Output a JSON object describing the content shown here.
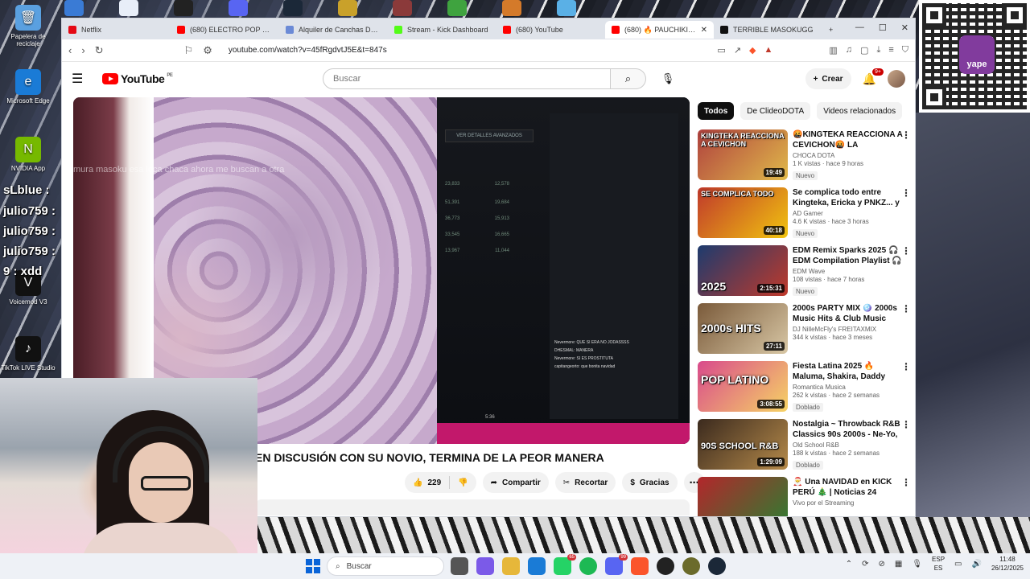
{
  "desktop": {
    "icons": [
      {
        "label": "Papelera de reciclaje",
        "color": "#5aa0e0",
        "glyph": "🗑"
      },
      {
        "label": "Microsoft Edge",
        "color": "#1a7bd6",
        "glyph": "e"
      },
      {
        "label": "NVIDIA App",
        "color": "#76b900",
        "glyph": "N"
      },
      {
        "label": "Voicemod V3",
        "color": "#111111",
        "glyph": "V"
      },
      {
        "label": "TikTok LIVE Studio",
        "color": "#111111",
        "glyph": "♪"
      }
    ],
    "overlay_names": [
      "sLblue :",
      "julio759 :",
      "julio759 :",
      "julio759 :",
      "9 : xdd"
    ]
  },
  "browser": {
    "tabs": [
      {
        "label": "Netflix",
        "favicon_color": "#e50914",
        "active": false
      },
      {
        "label": "(680) ELECTRO POP MIX 2025",
        "favicon_color": "#ff0000",
        "active": false
      },
      {
        "label": "Alquiler de Canchas Deporti",
        "favicon_color": "#6b8ad6",
        "active": false
      },
      {
        "label": "Stream - Kick Dashboard",
        "favicon_color": "#53fc18",
        "active": false
      },
      {
        "label": "(680) YouTube",
        "favicon_color": "#ff0000",
        "active": false
      },
      {
        "label": "(680) 🔥 PAUCHIKITA PI",
        "favicon_color": "#ff0000",
        "active": true
      },
      {
        "label": "TERRIBLE MASOKUGG",
        "favicon_color": "#111111",
        "active": false
      }
    ],
    "url": "youtube.com/watch?v=45fRgdvtJ5E&t=847s"
  },
  "youtube": {
    "logo_text": "YouTube",
    "region": "PE",
    "search_placeholder": "Buscar",
    "create_label": "Crear",
    "notif_count": "9+",
    "video": {
      "title": "EN DISCUSIÓN CON SU NOVIO, TERMINA DE LA PEOR MANERA",
      "overlay_caption": "mura masoku esa loca chaca ahora me buscan a otra",
      "stream_button": "VER DETALLES AVANZADOS",
      "stream_time": "5:36",
      "likes": "229",
      "share_label": "Compartir",
      "clip_label": "Recortar",
      "thanks_label": "Gracias"
    },
    "chips": [
      "Todos",
      "De ClideoDOTA",
      "Videos relacionados"
    ],
    "recommendations": [
      {
        "title": "🤬KINGTEKA REACCIONA A CEVICHON🤬 LA DECADENCI...",
        "channel": "CHOCA DOTA",
        "meta": "1 K vistas · hace 9 horas",
        "badge": "Nuevo",
        "duration": "19:49",
        "thumb_text": "KINGTEKA REACCIONA A CEVICHON",
        "thumb_color": "#b0413e"
      },
      {
        "title": "Se complica todo entre Kingteka, Ericka y PNKZ... y ...",
        "channel": "AD Gamer",
        "meta": "4.6 K vistas · hace 3 horas",
        "badge": "Nuevo",
        "duration": "40:18",
        "thumb_text": "SE COMPLICA TODO",
        "thumb_color": "#c0392b"
      },
      {
        "title": "EDM Remix Sparks 2025 🎧 EDM Compilation Playlist 🎧 ...",
        "channel": "EDM Wave",
        "meta": "108 vistas · hace 7 horas",
        "badge": "Nuevo",
        "duration": "2:15:31",
        "thumb_text": "2025",
        "thumb_color": "#1d3b6e"
      },
      {
        "title": "2000s PARTY MIX 🪩 2000s Music Hits & Club Music Mixe...",
        "channel": "DJ NilleMcFly's FREITAXMIX",
        "meta": "344 k vistas · hace 3 meses",
        "badge": "",
        "duration": "27:11",
        "thumb_text": "2000s HITS",
        "thumb_color": "#7a5a3a"
      },
      {
        "title": "Fiesta Latina 2025 🔥 Maluma, Shakira, Daddy Yankee, Wisin, ...",
        "channel": "Romantica Musica",
        "meta": "262 k vistas · hace 2 semanas",
        "badge": "Doblado",
        "duration": "3:08:55",
        "thumb_text": "POP LATINO",
        "thumb_color": "#d94a8c"
      },
      {
        "title": "Nostalgia ~ Throwback R&B Classics 90s 2000s - Ne-Yo, ...",
        "channel": "Old School R&B",
        "meta": "188 k vistas · hace 2 semanas",
        "badge": "Doblado",
        "duration": "1:29:09",
        "thumb_text": "90S SCHOOL R&B",
        "thumb_color": "#5a3d2b"
      },
      {
        "title": "🎅 Una NAVIDAD en KICK PERÚ 🎄 | Noticias 24 diciembre",
        "channel": "Vivo por el Streaming",
        "meta": "",
        "badge": "",
        "duration": "",
        "thumb_text": "",
        "thumb_color": "#b3262b"
      }
    ]
  },
  "qr": {
    "brand": "yape"
  },
  "taskbar": {
    "search_placeholder": "Buscar",
    "apps": [
      {
        "name": "file-explorer",
        "color": "#555",
        "badge": ""
      },
      {
        "name": "copilot",
        "color": "#7b5ae8",
        "badge": ""
      },
      {
        "name": "folder",
        "color": "#e6b73a",
        "badge": ""
      },
      {
        "name": "edge",
        "color": "#1a7bd6",
        "badge": ""
      },
      {
        "name": "whatsapp",
        "color": "#25d366",
        "badge": "65"
      },
      {
        "name": "spotify",
        "color": "#1db954",
        "badge": ""
      },
      {
        "name": "discord",
        "color": "#5865f2",
        "badge": "99"
      },
      {
        "name": "brave",
        "color": "#fb542b",
        "badge": ""
      },
      {
        "name": "obs",
        "color": "#222",
        "badge": ""
      },
      {
        "name": "unknown-app",
        "color": "#6b6b2b",
        "badge": ""
      },
      {
        "name": "steam",
        "color": "#1b2838",
        "badge": ""
      }
    ],
    "lang_top": "ESP",
    "lang_bottom": "ES",
    "time": "11:48",
    "date": "26/12/2025"
  }
}
